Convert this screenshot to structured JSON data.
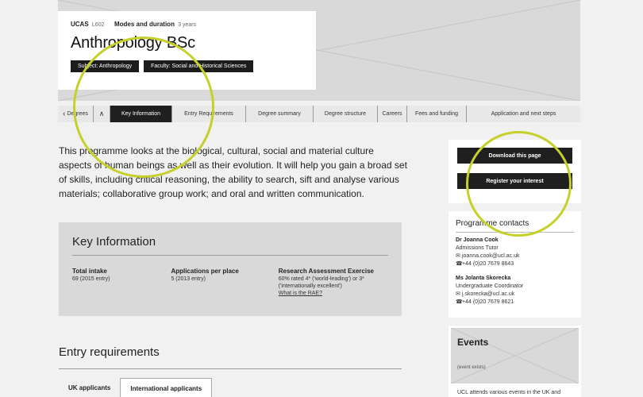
{
  "course": {
    "ucas_label": "UCAS",
    "ucas_code": "L602",
    "modes_label": "Modes and duration",
    "duration": "3 years",
    "title": "Anthropology BSc",
    "subject_badge": "Subject: Anthropology",
    "faculty_badge": "Faculty: Social and Historical Sciences"
  },
  "nav": {
    "degrees": "Degrees",
    "up": "^",
    "tabs": [
      "Key Information",
      "Entry Requirements",
      "Degree summary",
      "Degree structure",
      "Careers",
      "Fees and funding",
      "Application and next steps"
    ],
    "active": "Key Information"
  },
  "intro": "This programme looks at the biological, cultural, social and material culture aspects of human beings as well as their evolution. It will help you gain a broad set of skills, including critical reasoning, the ability to search, sift and analyse various materials; collaborative group work; and oral and written communication.",
  "key_info": {
    "title": "Key Information",
    "columns": [
      {
        "heading": "Total intake",
        "lines": [
          "69 (2015 entry)"
        ]
      },
      {
        "heading": "Applications per place",
        "lines": [
          "5 (2013 entry)"
        ]
      },
      {
        "heading": "Research Assessment Exercise",
        "lines": [
          "60% rated 4* ('world-leading') or 3*",
          "('internationally excellent')"
        ],
        "link": "What is the RAE?"
      }
    ]
  },
  "entry": {
    "title": "Entry requirements",
    "tabs": [
      "UK applicants",
      "International applicants"
    ],
    "active": "International applicants"
  },
  "sidebar": {
    "download_label": "Download this page",
    "register_label": "Register your interest",
    "contacts_title": "Programme contacts",
    "contacts": [
      {
        "name": "Dr Joanna Cook",
        "role": "Admissions Tutor",
        "email": "joanna.cook@ucl.ac.uk",
        "phone": "+44 (0)20 7679 8643"
      },
      {
        "name": "Ms Jolanta Skorecka",
        "role": "Undergraduate Coordinator",
        "email": "j.skorecka@ucl.ac.uk",
        "phone": "+44 (0)20 7679 8621"
      }
    ],
    "events_title": "Events",
    "events_flag": "(event exists)",
    "events_text": "UCL attends various events in the UK and"
  },
  "icons": {
    "back": "‹",
    "up": "∧",
    "email": "✉",
    "phone": "☎"
  },
  "colors": {
    "highlight": "#c5d02a",
    "dark": "#1f1f1f"
  }
}
